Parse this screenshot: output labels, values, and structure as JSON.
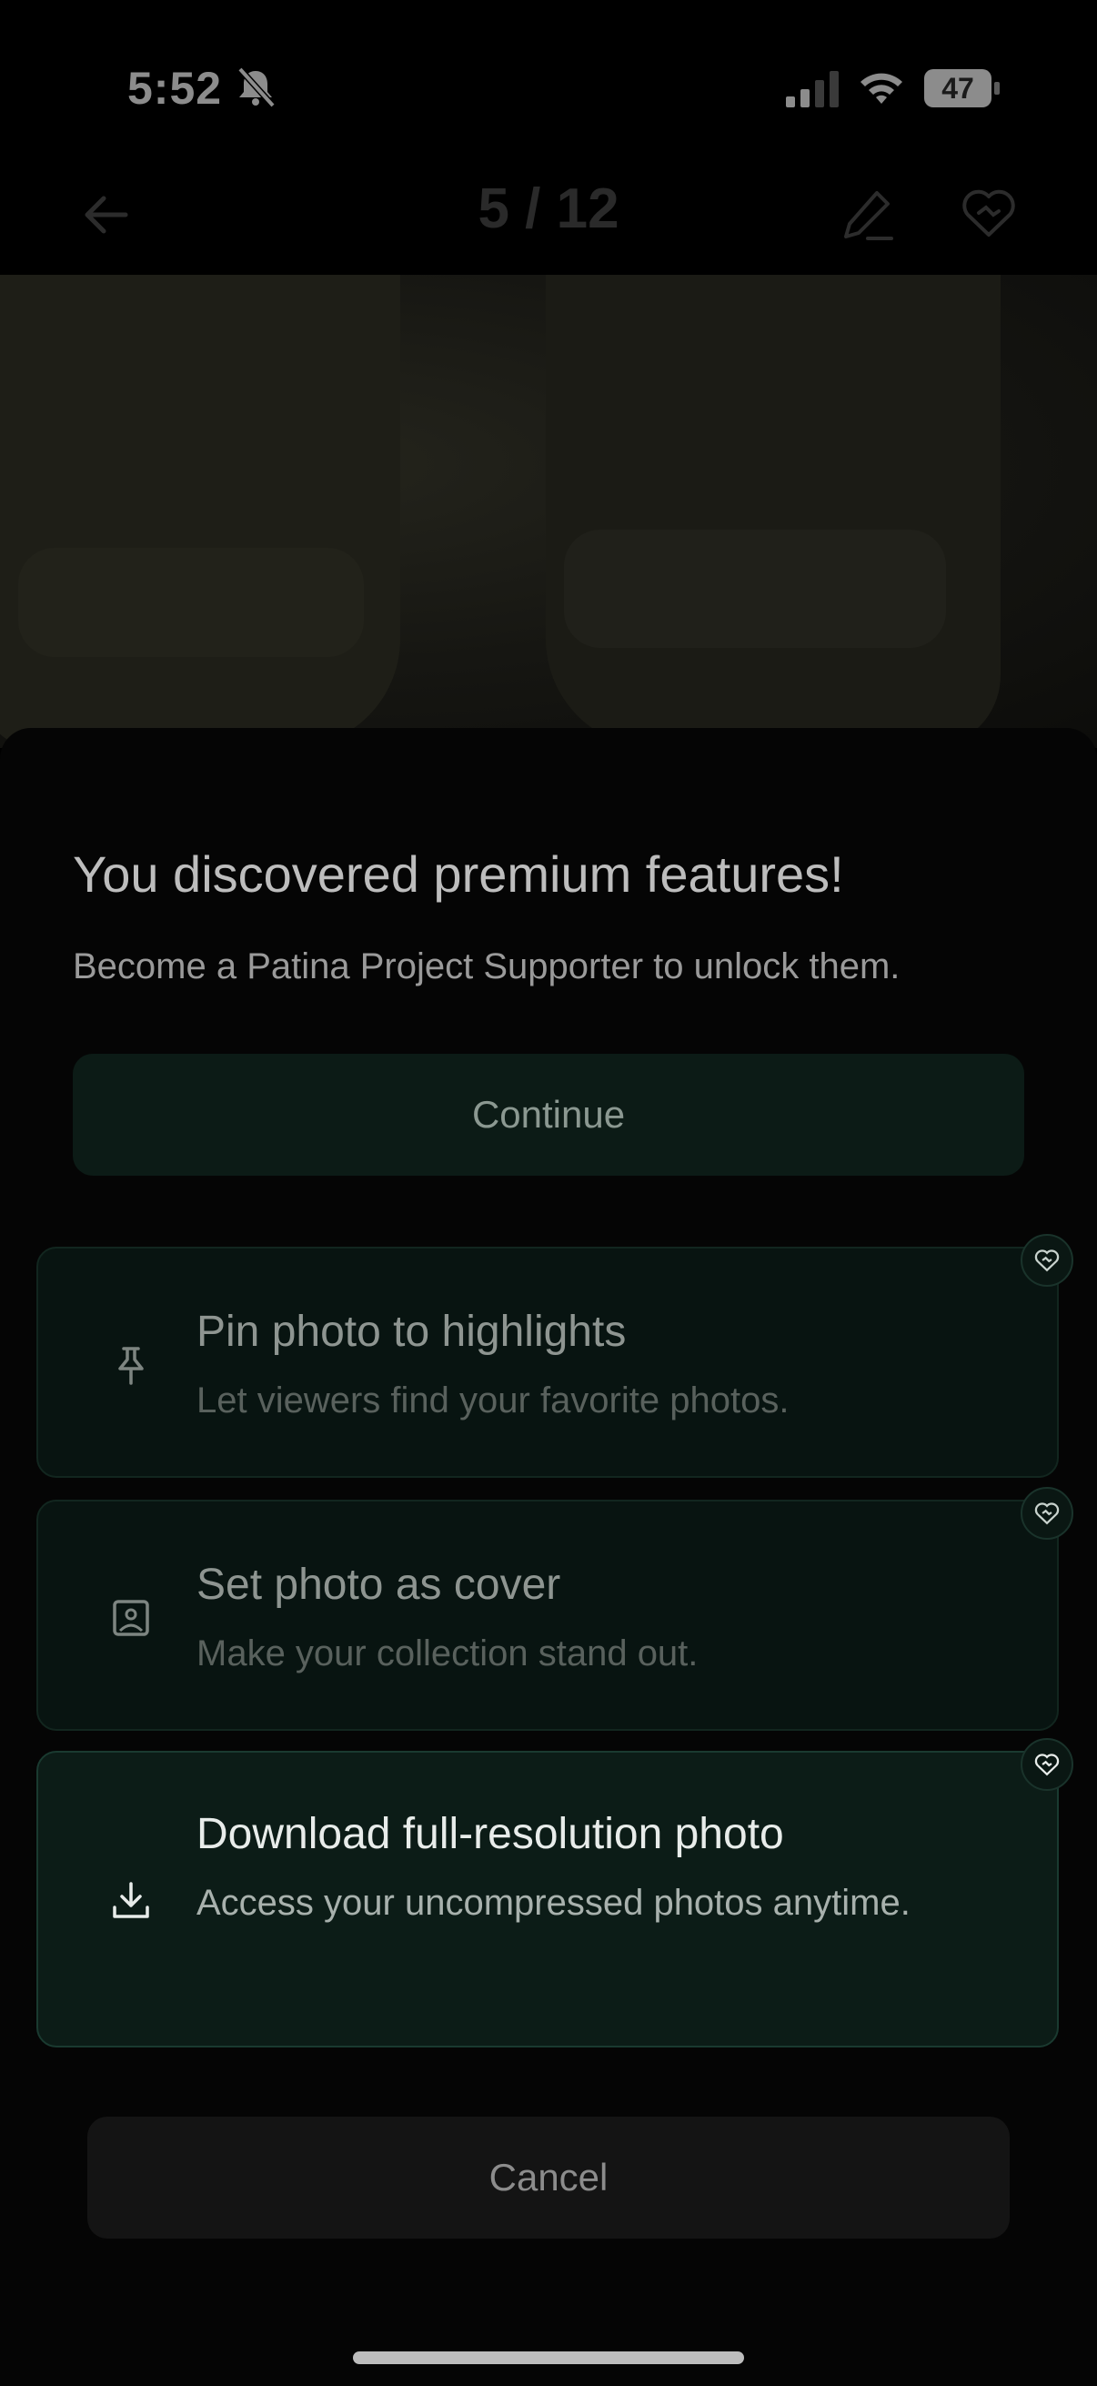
{
  "status_bar": {
    "time": "5:52",
    "battery": "47"
  },
  "header": {
    "counter": "5 / 12"
  },
  "sheet": {
    "title": "You discovered premium features!",
    "subtitle": "Become a Patina Project Supporter to unlock them.",
    "continue_label": "Continue",
    "features": [
      {
        "title": "Pin photo to highlights",
        "description": "Let viewers find your favorite photos.",
        "icon": "pin-icon"
      },
      {
        "title": "Set photo as cover",
        "description": "Make your collection stand out.",
        "icon": "image-icon"
      },
      {
        "title": "Download full-resolution photo",
        "description": "Access your uncompressed photos anytime.",
        "icon": "download-icon"
      }
    ],
    "cancel_label": "Cancel"
  },
  "colors": {
    "accent_dark": "#0c1b16",
    "background": "#050505"
  }
}
